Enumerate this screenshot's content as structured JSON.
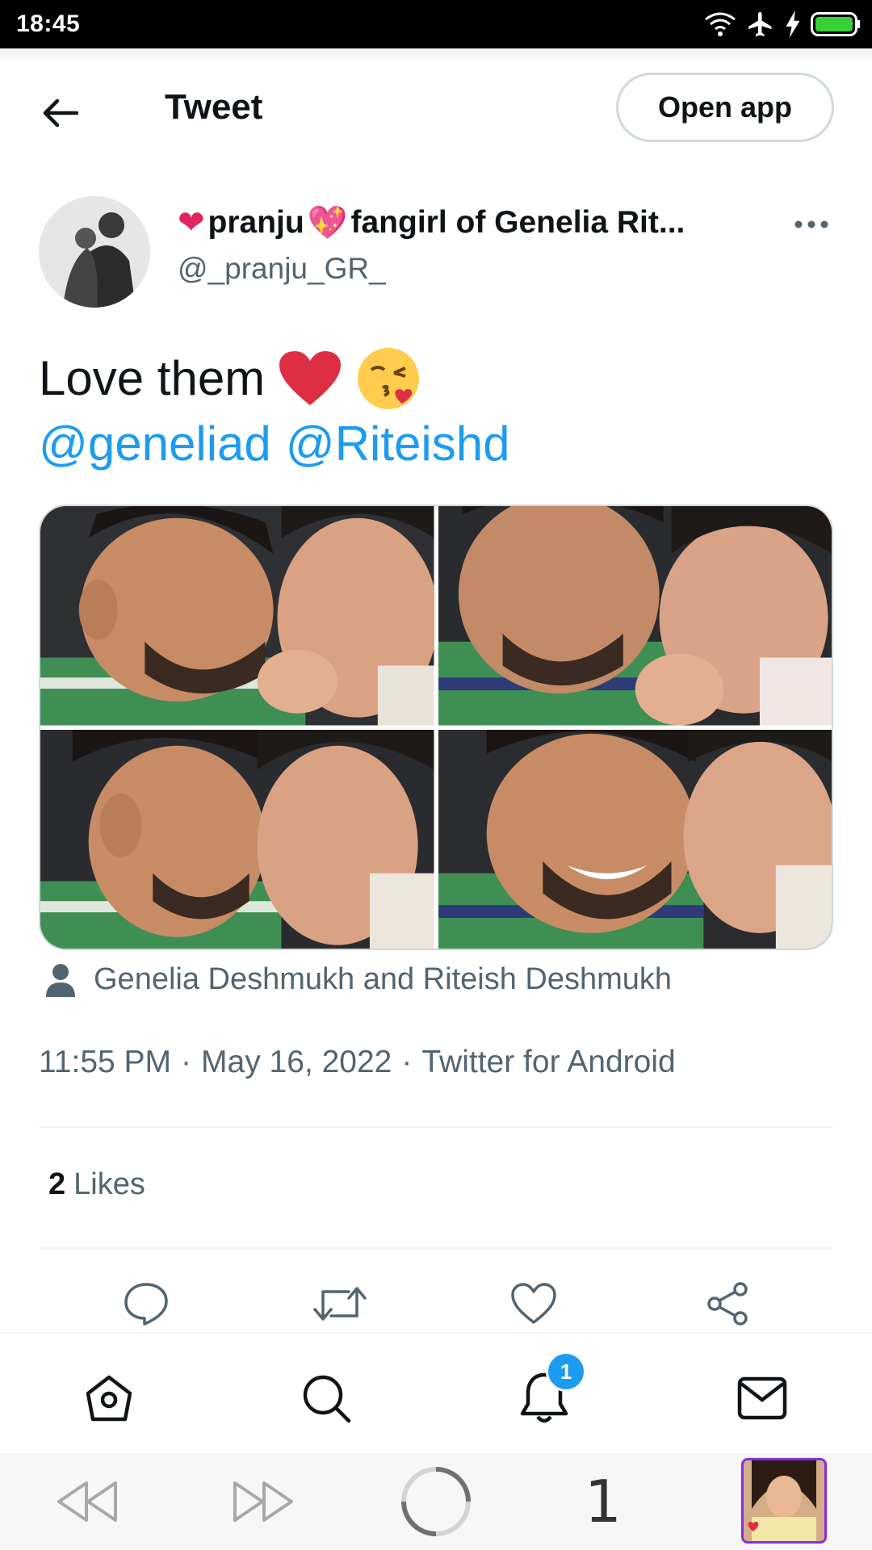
{
  "status_bar": {
    "time": "18:45"
  },
  "header": {
    "title": "Tweet",
    "open_app_label": "Open app"
  },
  "tweet": {
    "author": {
      "display_name_part1": "pranju",
      "display_name_part2": "fangirl of Genelia Rit...",
      "username": "@_pranju_GR_"
    },
    "text": "Love them",
    "mentions": [
      "@geneliad",
      "@Riteishd"
    ],
    "tagged_people": "Genelia Deshmukh and Riteish Deshmukh",
    "time": "11:55 PM",
    "date": "May 16, 2022",
    "source": "Twitter for Android",
    "likes_count": "2",
    "likes_label": "Likes"
  },
  "tabbar": {
    "notifications_badge": "1"
  },
  "browser_nav": {
    "tab_count": "1"
  },
  "colors": {
    "accent": "#1d9bf0",
    "text": "#0f1419",
    "secondary": "#536471",
    "heart": "#e0245e"
  },
  "icons": [
    "back-arrow-icon",
    "more-icon",
    "reply-icon",
    "retweet-icon",
    "like-icon",
    "share-icon",
    "home-icon",
    "search-icon",
    "bell-icon",
    "mail-icon",
    "rewind-icon",
    "forward-icon",
    "reload-icon",
    "person-icon"
  ]
}
